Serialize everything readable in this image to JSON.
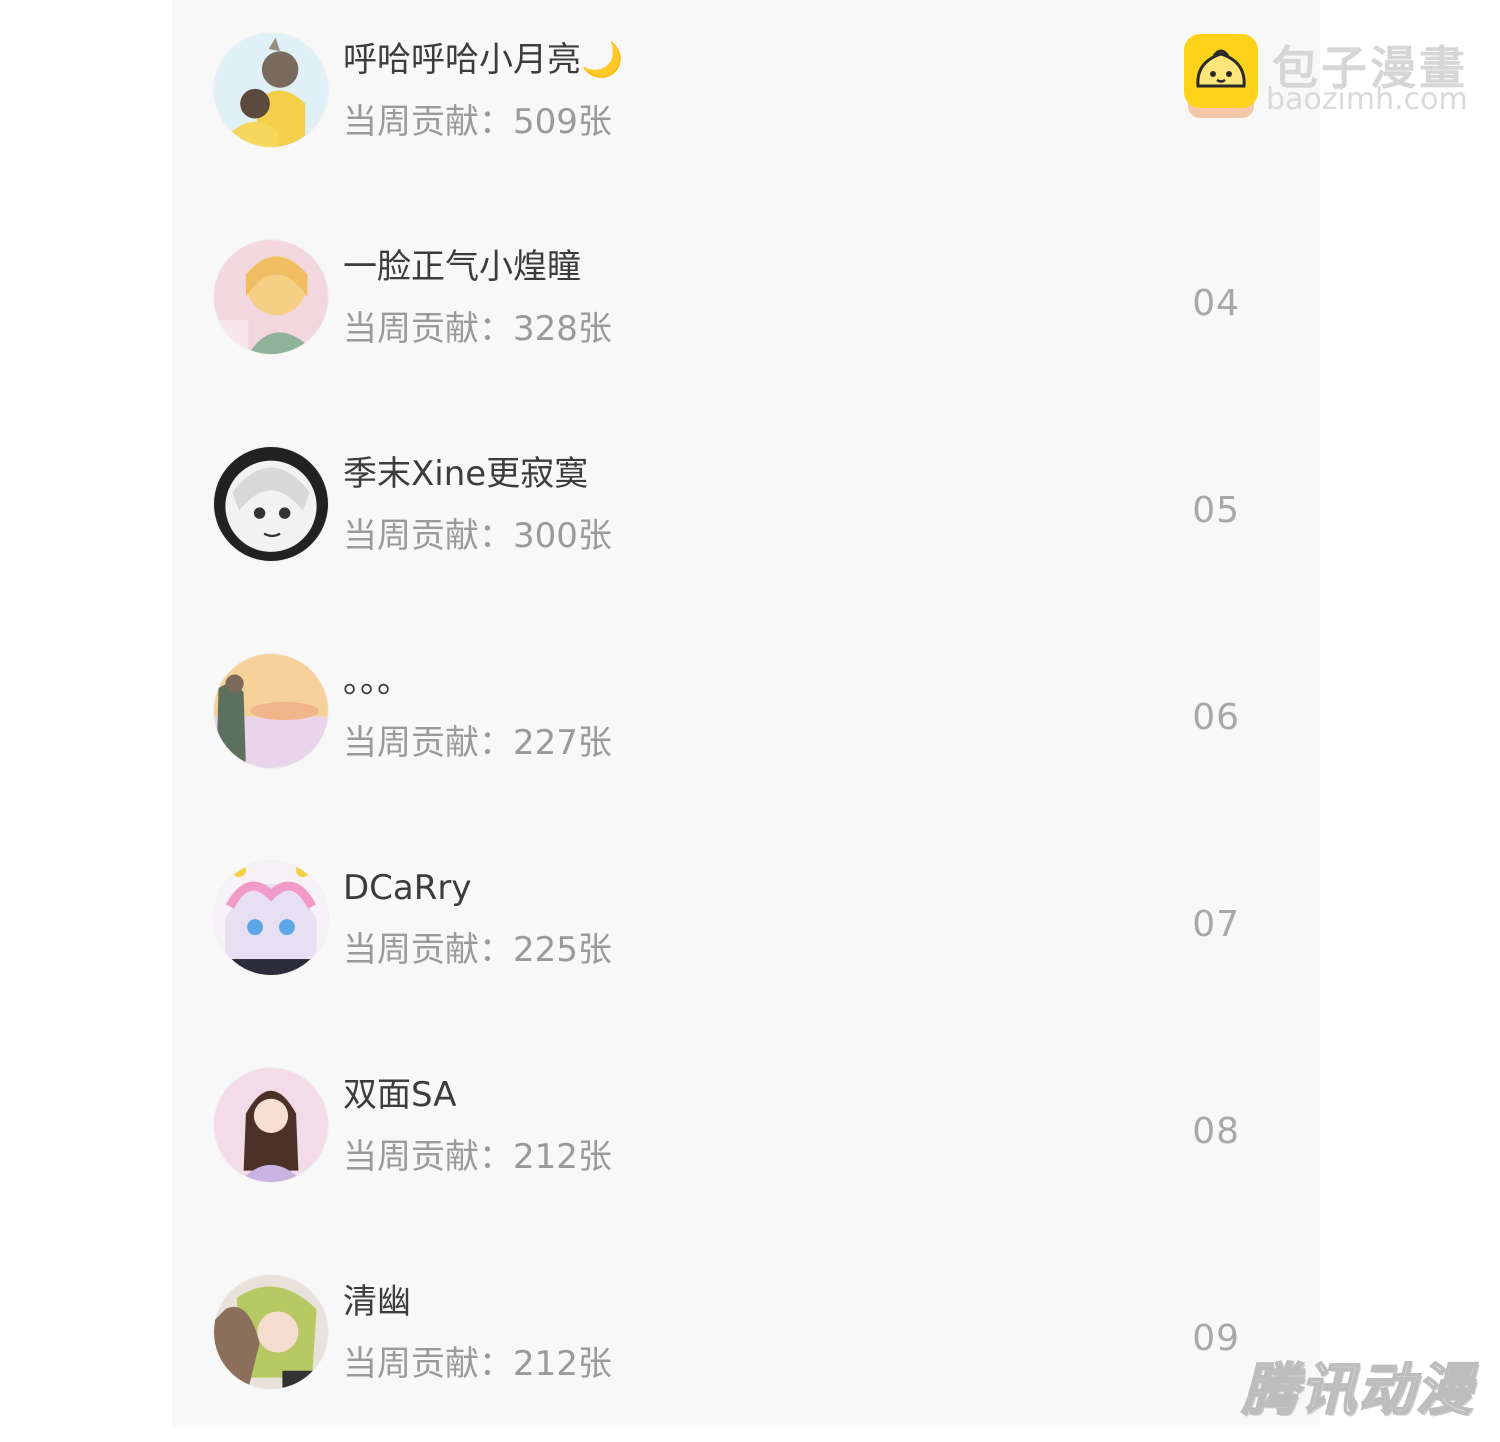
{
  "ranking": {
    "rows": [
      {
        "name": "呼哈呼哈小月亮🌙",
        "contribution": "当周贡献：509张",
        "rank": ""
      },
      {
        "name": "一脸正气小煌瞳",
        "contribution": "当周贡献：328张",
        "rank": "04"
      },
      {
        "name": "季末Xine更寂寞",
        "contribution": "当周贡献：300张",
        "rank": "05"
      },
      {
        "name": "。。。",
        "contribution": "当周贡献：227张",
        "rank": "06"
      },
      {
        "name": "DCaRry",
        "contribution": "当周贡献：225张",
        "rank": "07"
      },
      {
        "name": "双面SA",
        "contribution": "当周贡献：212张",
        "rank": "08"
      },
      {
        "name": "清幽",
        "contribution": "当周贡献：212张",
        "rank": "09"
      }
    ]
  },
  "watermarks": {
    "site_title": "包子漫畫",
    "site_url": "baozimh.com",
    "publisher": "腾讯动漫"
  },
  "colors": {
    "panel_bg": "#f8f8f8",
    "name_text": "#3c3c3c",
    "secondary_text": "#9a9a9a",
    "logo_yellow": "#ffd21a"
  }
}
